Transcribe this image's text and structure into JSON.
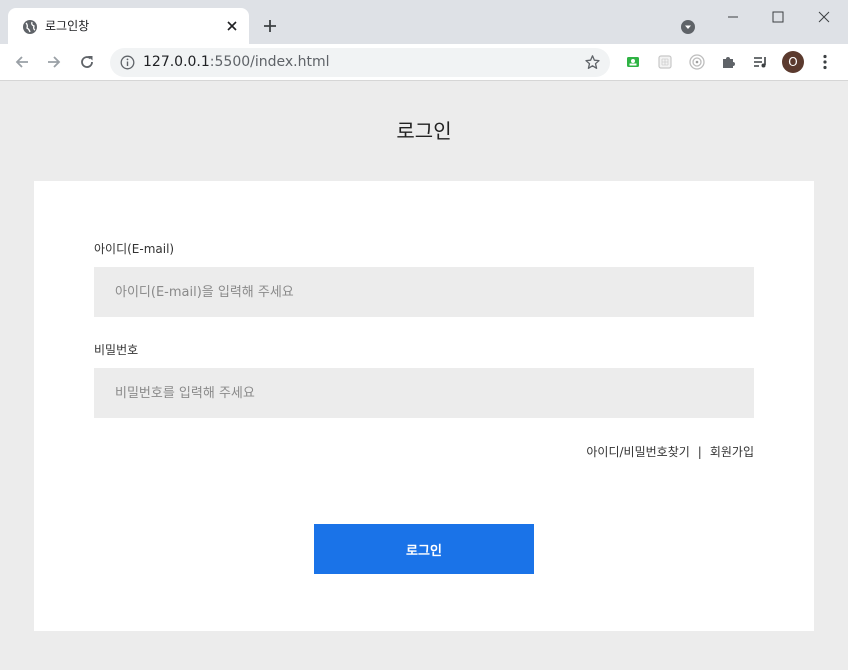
{
  "browser": {
    "tab_title": "로그인창",
    "url_host": "127.0.0.1",
    "url_path": ":5500/index.html",
    "avatar_letter": "O",
    "icons": {
      "favicon": "globe-icon",
      "close": "close-icon",
      "new_tab": "plus-icon",
      "back": "back-arrow-icon",
      "forward": "forward-arrow-icon",
      "reload": "reload-icon",
      "site_info": "info-icon",
      "bookmark": "star-icon",
      "extensions": [
        "screencast-extension-icon",
        "grid-extension-icon",
        "target-extension-icon",
        "puzzle-icon",
        "media-queue-icon"
      ],
      "menu": "kebab-menu-icon"
    }
  },
  "login": {
    "title": "로그인",
    "id_label": "아이디(E-mail)",
    "id_placeholder": "아이디(E-mail)을 입력해 주세요",
    "id_value": "",
    "pw_label": "비밀번호",
    "pw_placeholder": "비밀번호를 입력해 주세요",
    "pw_value": "",
    "find_link": "아이디/비밀번호찾기",
    "separator": "|",
    "signup_link": "회원가입",
    "submit_label": "로그인"
  },
  "colors": {
    "accent": "#1a73e8",
    "page_bg": "#ececec",
    "card_bg": "#ffffff",
    "input_bg": "#ececec"
  }
}
